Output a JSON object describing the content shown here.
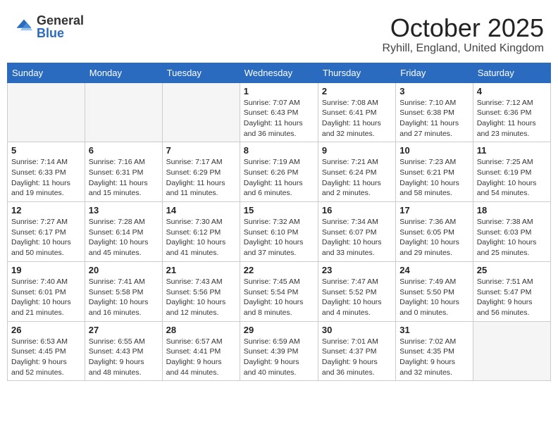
{
  "logo": {
    "general": "General",
    "blue": "Blue"
  },
  "title": {
    "month": "October 2025",
    "location": "Ryhill, England, United Kingdom"
  },
  "days_of_week": [
    "Sunday",
    "Monday",
    "Tuesday",
    "Wednesday",
    "Thursday",
    "Friday",
    "Saturday"
  ],
  "weeks": [
    [
      {
        "day": "",
        "info": ""
      },
      {
        "day": "",
        "info": ""
      },
      {
        "day": "",
        "info": ""
      },
      {
        "day": "1",
        "info": "Sunrise: 7:07 AM\nSunset: 6:43 PM\nDaylight: 11 hours\nand 36 minutes."
      },
      {
        "day": "2",
        "info": "Sunrise: 7:08 AM\nSunset: 6:41 PM\nDaylight: 11 hours\nand 32 minutes."
      },
      {
        "day": "3",
        "info": "Sunrise: 7:10 AM\nSunset: 6:38 PM\nDaylight: 11 hours\nand 27 minutes."
      },
      {
        "day": "4",
        "info": "Sunrise: 7:12 AM\nSunset: 6:36 PM\nDaylight: 11 hours\nand 23 minutes."
      }
    ],
    [
      {
        "day": "5",
        "info": "Sunrise: 7:14 AM\nSunset: 6:33 PM\nDaylight: 11 hours\nand 19 minutes."
      },
      {
        "day": "6",
        "info": "Sunrise: 7:16 AM\nSunset: 6:31 PM\nDaylight: 11 hours\nand 15 minutes."
      },
      {
        "day": "7",
        "info": "Sunrise: 7:17 AM\nSunset: 6:29 PM\nDaylight: 11 hours\nand 11 minutes."
      },
      {
        "day": "8",
        "info": "Sunrise: 7:19 AM\nSunset: 6:26 PM\nDaylight: 11 hours\nand 6 minutes."
      },
      {
        "day": "9",
        "info": "Sunrise: 7:21 AM\nSunset: 6:24 PM\nDaylight: 11 hours\nand 2 minutes."
      },
      {
        "day": "10",
        "info": "Sunrise: 7:23 AM\nSunset: 6:21 PM\nDaylight: 10 hours\nand 58 minutes."
      },
      {
        "day": "11",
        "info": "Sunrise: 7:25 AM\nSunset: 6:19 PM\nDaylight: 10 hours\nand 54 minutes."
      }
    ],
    [
      {
        "day": "12",
        "info": "Sunrise: 7:27 AM\nSunset: 6:17 PM\nDaylight: 10 hours\nand 50 minutes."
      },
      {
        "day": "13",
        "info": "Sunrise: 7:28 AM\nSunset: 6:14 PM\nDaylight: 10 hours\nand 45 minutes."
      },
      {
        "day": "14",
        "info": "Sunrise: 7:30 AM\nSunset: 6:12 PM\nDaylight: 10 hours\nand 41 minutes."
      },
      {
        "day": "15",
        "info": "Sunrise: 7:32 AM\nSunset: 6:10 PM\nDaylight: 10 hours\nand 37 minutes."
      },
      {
        "day": "16",
        "info": "Sunrise: 7:34 AM\nSunset: 6:07 PM\nDaylight: 10 hours\nand 33 minutes."
      },
      {
        "day": "17",
        "info": "Sunrise: 7:36 AM\nSunset: 6:05 PM\nDaylight: 10 hours\nand 29 minutes."
      },
      {
        "day": "18",
        "info": "Sunrise: 7:38 AM\nSunset: 6:03 PM\nDaylight: 10 hours\nand 25 minutes."
      }
    ],
    [
      {
        "day": "19",
        "info": "Sunrise: 7:40 AM\nSunset: 6:01 PM\nDaylight: 10 hours\nand 21 minutes."
      },
      {
        "day": "20",
        "info": "Sunrise: 7:41 AM\nSunset: 5:58 PM\nDaylight: 10 hours\nand 16 minutes."
      },
      {
        "day": "21",
        "info": "Sunrise: 7:43 AM\nSunset: 5:56 PM\nDaylight: 10 hours\nand 12 minutes."
      },
      {
        "day": "22",
        "info": "Sunrise: 7:45 AM\nSunset: 5:54 PM\nDaylight: 10 hours\nand 8 minutes."
      },
      {
        "day": "23",
        "info": "Sunrise: 7:47 AM\nSunset: 5:52 PM\nDaylight: 10 hours\nand 4 minutes."
      },
      {
        "day": "24",
        "info": "Sunrise: 7:49 AM\nSunset: 5:50 PM\nDaylight: 10 hours\nand 0 minutes."
      },
      {
        "day": "25",
        "info": "Sunrise: 7:51 AM\nSunset: 5:47 PM\nDaylight: 9 hours\nand 56 minutes."
      }
    ],
    [
      {
        "day": "26",
        "info": "Sunrise: 6:53 AM\nSunset: 4:45 PM\nDaylight: 9 hours\nand 52 minutes."
      },
      {
        "day": "27",
        "info": "Sunrise: 6:55 AM\nSunset: 4:43 PM\nDaylight: 9 hours\nand 48 minutes."
      },
      {
        "day": "28",
        "info": "Sunrise: 6:57 AM\nSunset: 4:41 PM\nDaylight: 9 hours\nand 44 minutes."
      },
      {
        "day": "29",
        "info": "Sunrise: 6:59 AM\nSunset: 4:39 PM\nDaylight: 9 hours\nand 40 minutes."
      },
      {
        "day": "30",
        "info": "Sunrise: 7:01 AM\nSunset: 4:37 PM\nDaylight: 9 hours\nand 36 minutes."
      },
      {
        "day": "31",
        "info": "Sunrise: 7:02 AM\nSunset: 4:35 PM\nDaylight: 9 hours\nand 32 minutes."
      },
      {
        "day": "",
        "info": ""
      }
    ]
  ]
}
